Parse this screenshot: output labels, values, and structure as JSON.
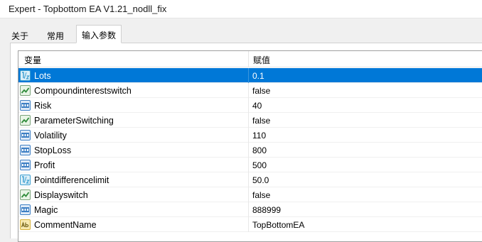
{
  "window": {
    "title": "Expert - Topbottom EA V1.21_nodll_fix"
  },
  "tabs": [
    {
      "label": "关于",
      "active": false
    },
    {
      "label": "常用",
      "active": false
    },
    {
      "label": "输入参数",
      "active": true
    }
  ],
  "grid": {
    "columns": {
      "variable": "变量",
      "value": "赋值"
    },
    "rows": [
      {
        "icon": "double-icon",
        "name": "Lots",
        "value": "0.1",
        "selected": true
      },
      {
        "icon": "bool-icon",
        "name": "Compoundinterestswitch",
        "value": "false",
        "selected": false
      },
      {
        "icon": "int-icon",
        "name": "Risk",
        "value": "40",
        "selected": false
      },
      {
        "icon": "bool-icon",
        "name": "ParameterSwitching",
        "value": "false",
        "selected": false
      },
      {
        "icon": "int-icon",
        "name": "Volatility",
        "value": "110",
        "selected": false
      },
      {
        "icon": "int-icon",
        "name": "StopLoss",
        "value": "800",
        "selected": false
      },
      {
        "icon": "int-icon",
        "name": "Profit",
        "value": "500",
        "selected": false
      },
      {
        "icon": "double-icon",
        "name": "Pointdifferencelimit",
        "value": "50.0",
        "selected": false
      },
      {
        "icon": "bool-icon",
        "name": "Displayswitch",
        "value": "false",
        "selected": false
      },
      {
        "icon": "int-icon",
        "name": "Magic",
        "value": "888999",
        "selected": false
      },
      {
        "icon": "string-icon",
        "name": "CommentName",
        "value": "TopBottomEA",
        "selected": false
      }
    ]
  },
  "colors": {
    "selection": "#0078d7",
    "int_icon": "#3d7fc4",
    "bool_icon": "#2e8b3a",
    "string_icon": "#d8b23a",
    "double_icon": "#3d9fd0"
  }
}
